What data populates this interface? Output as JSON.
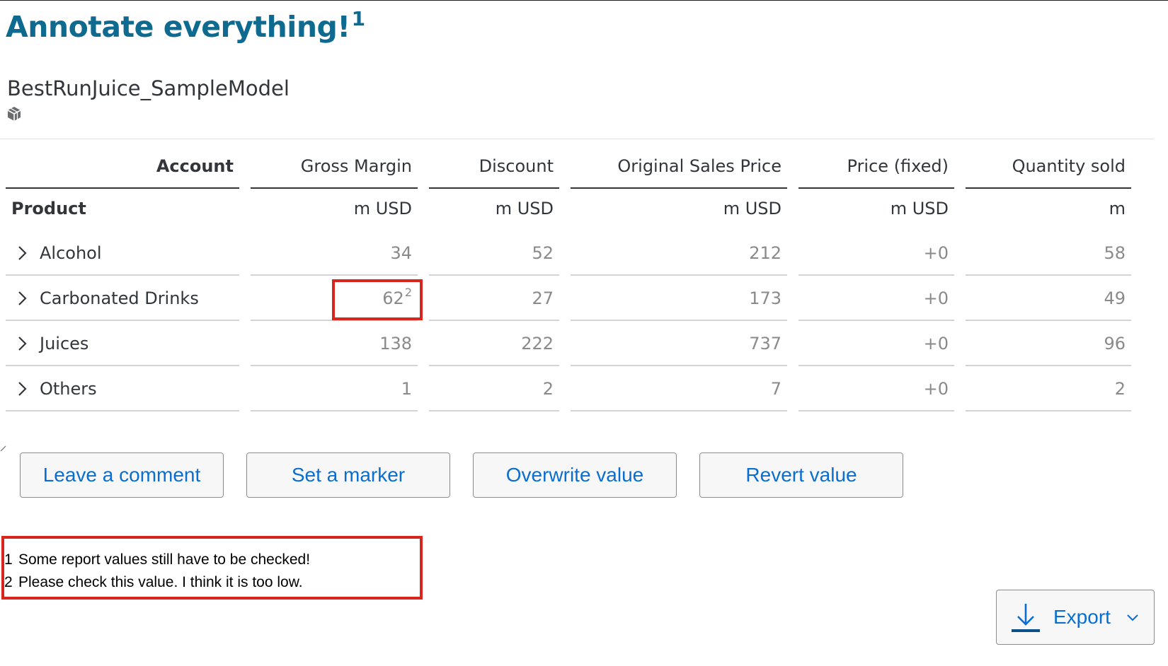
{
  "header": {
    "title": "Annotate everything!",
    "title_footnote": "1",
    "model_name": "BestRunJuice_SampleModel",
    "model_icon": "cube-icon"
  },
  "table": {
    "account_header": "Account",
    "product_header": "Product",
    "columns": [
      {
        "label": "Gross Margin",
        "unit": "m USD"
      },
      {
        "label": "Discount",
        "unit": "m USD"
      },
      {
        "label": "Original Sales Price",
        "unit": "m USD"
      },
      {
        "label": "Price (fixed)",
        "unit": "m USD"
      },
      {
        "label": "Quantity sold",
        "unit": "m"
      }
    ],
    "rows": [
      {
        "label": "Alcohol",
        "values": [
          "34",
          "52",
          "212",
          "+0",
          "58"
        ]
      },
      {
        "label": "Carbonated Drinks",
        "values": [
          "62",
          "27",
          "173",
          "+0",
          "49"
        ],
        "footnote": "2"
      },
      {
        "label": "Juices",
        "values": [
          "138",
          "222",
          "737",
          "+0",
          "96"
        ]
      },
      {
        "label": "Others",
        "values": [
          "1",
          "2",
          "7",
          "+0",
          "2"
        ]
      }
    ]
  },
  "buttons": {
    "leave_comment": "Leave a comment",
    "set_marker": "Set a marker",
    "overwrite_value": "Overwrite value",
    "revert_value": "Revert value"
  },
  "footnotes": [
    {
      "num": "1",
      "text": "Some report values still have to be checked!"
    },
    {
      "num": "2",
      "text": "Please check this value. I think it is too low."
    }
  ],
  "export": {
    "label": "Export",
    "icon": "download-icon"
  },
  "colors": {
    "title": "#0e6a8e",
    "accent": "#0a6ed1",
    "highlight": "#d8261f",
    "value_text": "#8a8a8a"
  }
}
